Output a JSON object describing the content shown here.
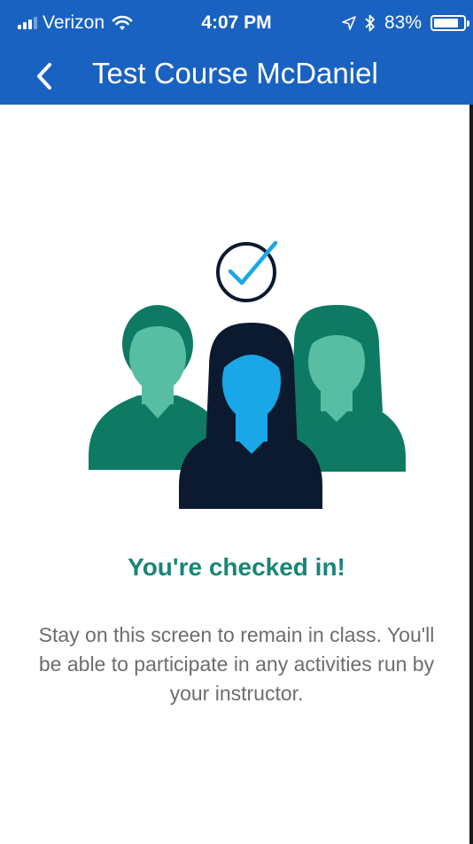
{
  "status_bar": {
    "carrier": "Verizon",
    "time": "4:07 PM",
    "battery_percent": "83%",
    "battery_level": 0.83,
    "signal_bars": 3,
    "icons": [
      "signal-icon",
      "wifi-icon",
      "location-arrow-icon",
      "bluetooth-icon",
      "battery-icon"
    ]
  },
  "nav": {
    "title": "Test Course McDaniel",
    "back_icon": "chevron-left-icon"
  },
  "content": {
    "illustration_icon": "checked-in-group-icon",
    "headline": "You're checked in!",
    "message": "Stay on this screen to remain in class. You'll be able to participate in any activities run by your instructor."
  },
  "colors": {
    "nav_bg": "#1a62c1",
    "headline": "#1a8577",
    "body_text": "#6d6d6d",
    "person_dark": "#0e7a63",
    "person_light": "#57bea4",
    "center_dark": "#0c1a30",
    "center_face": "#1aa7e8"
  }
}
